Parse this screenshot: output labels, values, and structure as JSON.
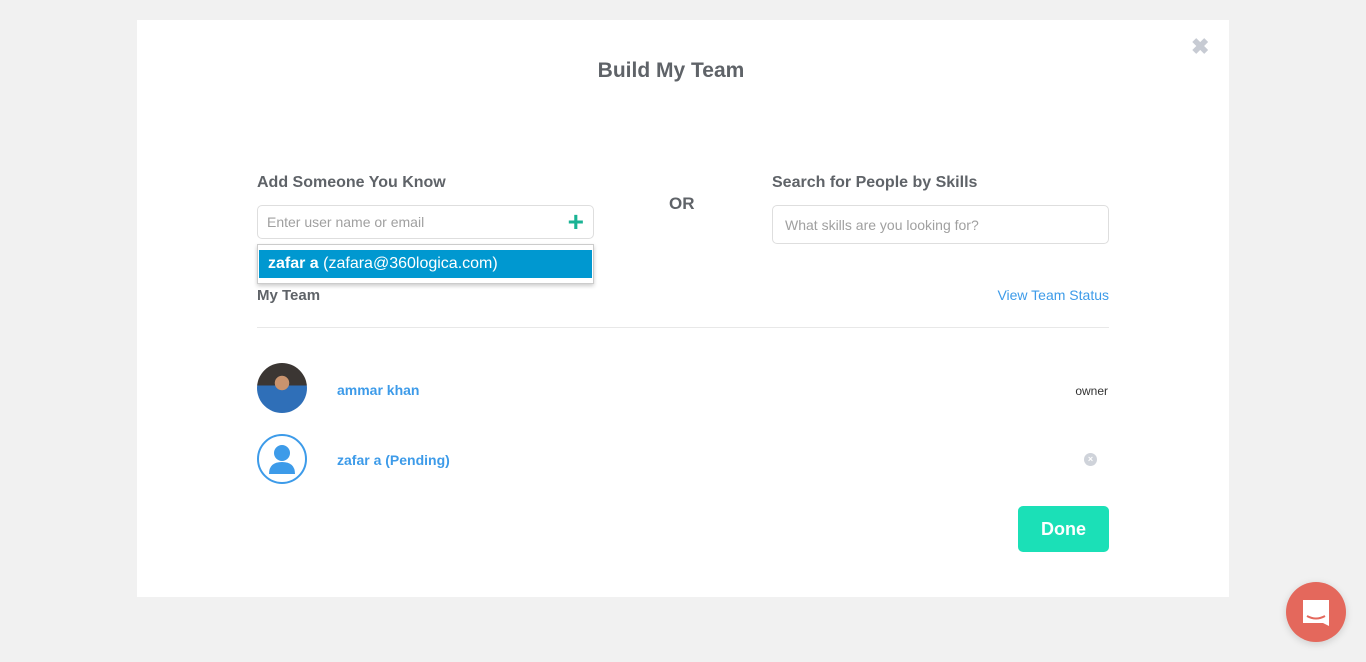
{
  "modal": {
    "title": "Build My Team",
    "close_icon": "close-icon"
  },
  "add": {
    "label": "Add Someone You Know",
    "placeholder": "Enter user name or email",
    "suggestion_name": "zafar a",
    "suggestion_email": "(zafara@360logica.com)"
  },
  "or_label": "OR",
  "search": {
    "label": "Search for People by Skills",
    "placeholder": "What skills are you looking for?"
  },
  "team": {
    "title": "My Team",
    "view_status": "View Team Status",
    "members": [
      {
        "name": "ammar khan",
        "role": "owner"
      },
      {
        "name": "zafar a (Pending)"
      }
    ]
  },
  "done_label": "Done",
  "colors": {
    "accent": "#1be0b7",
    "link": "#3d9be9",
    "highlight": "#0098d0",
    "chat": "#e4685c"
  }
}
